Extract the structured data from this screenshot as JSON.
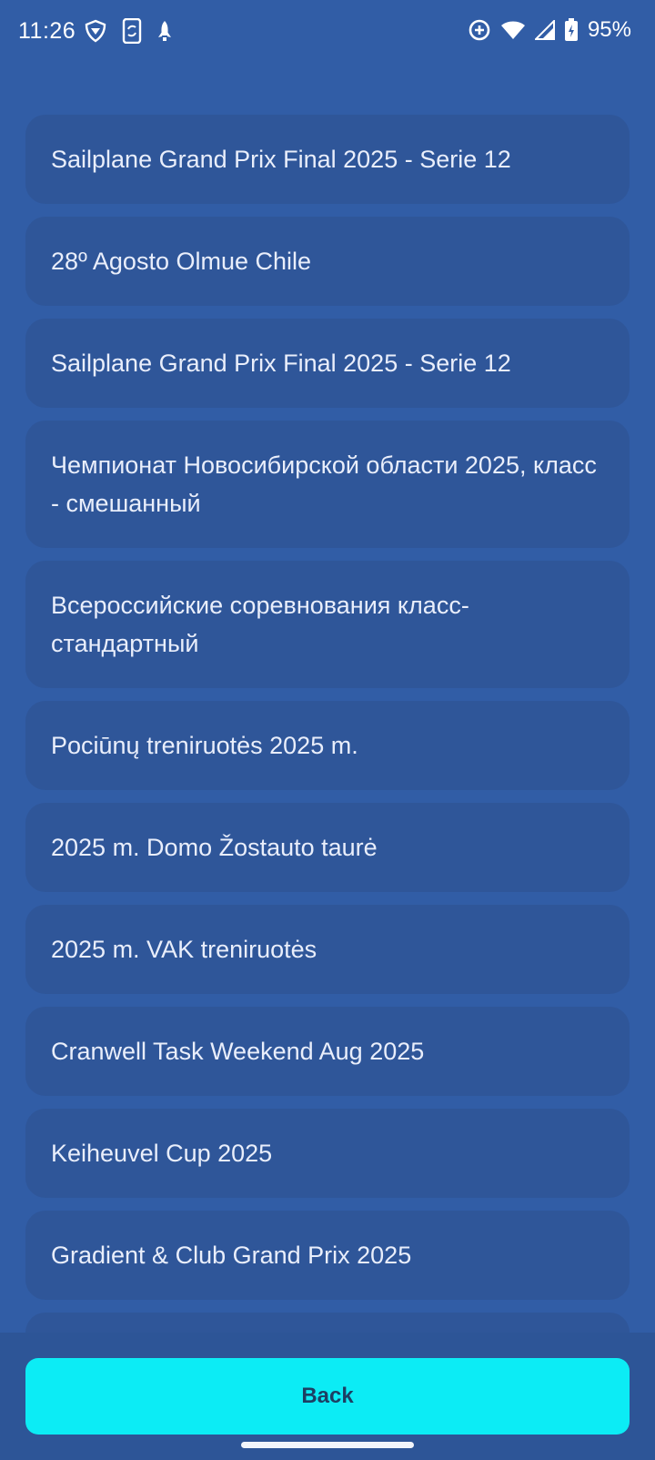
{
  "status_bar": {
    "time": "11:26",
    "battery": "95%",
    "left_icons": [
      "vpn-shield-icon",
      "phone-sync-icon",
      "rocket-icon"
    ],
    "right_icons": [
      "data-saver-icon",
      "wifi-icon",
      "cell-signal-icon",
      "battery-charging-icon"
    ]
  },
  "events": [
    {
      "label": "Sailplane Grand Prix Final 2025 - Serie 12"
    },
    {
      "label": "28º Agosto Olmue Chile"
    },
    {
      "label": "Sailplane Grand Prix Final 2025 - Serie 12"
    },
    {
      "label": "Чемпионат Новосибирской области 2025, класс - смешанный"
    },
    {
      "label": "Всероссийские соревнования класс-стандартный"
    },
    {
      "label": "Pociūnų treniruotės 2025 m."
    },
    {
      "label": "2025 m. Domo Žostauto taurė"
    },
    {
      "label": "2025 m. VAK treniruotės"
    },
    {
      "label": "Cranwell Task Weekend Aug 2025"
    },
    {
      "label": "Keiheuvel Cup 2025"
    },
    {
      "label": "Gradient & Club Grand Prix 2025"
    }
  ],
  "footer": {
    "back_label": "Back"
  },
  "colors": {
    "background": "#315da6",
    "card": "#2f5699",
    "accent": "#0cecf5"
  }
}
